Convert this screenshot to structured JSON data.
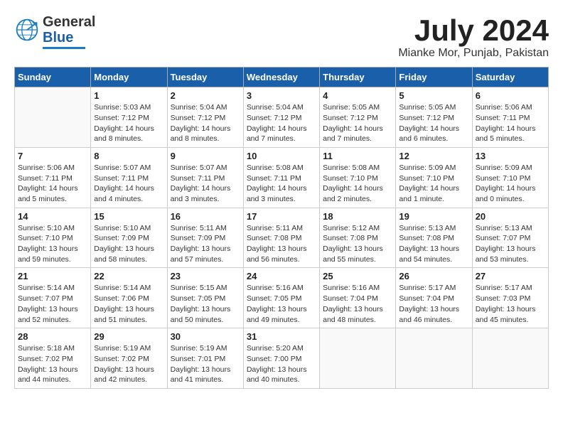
{
  "header": {
    "logo": {
      "line1": "General",
      "line2": "Blue"
    },
    "month": "July 2024",
    "location": "Mianke Mor, Punjab, Pakistan"
  },
  "columns": [
    "Sunday",
    "Monday",
    "Tuesday",
    "Wednesday",
    "Thursday",
    "Friday",
    "Saturday"
  ],
  "weeks": [
    [
      {
        "day": "",
        "sunrise": "",
        "sunset": "",
        "daylight": ""
      },
      {
        "day": "1",
        "sunrise": "Sunrise: 5:03 AM",
        "sunset": "Sunset: 7:12 PM",
        "daylight": "Daylight: 14 hours and 8 minutes."
      },
      {
        "day": "2",
        "sunrise": "Sunrise: 5:04 AM",
        "sunset": "Sunset: 7:12 PM",
        "daylight": "Daylight: 14 hours and 8 minutes."
      },
      {
        "day": "3",
        "sunrise": "Sunrise: 5:04 AM",
        "sunset": "Sunset: 7:12 PM",
        "daylight": "Daylight: 14 hours and 7 minutes."
      },
      {
        "day": "4",
        "sunrise": "Sunrise: 5:05 AM",
        "sunset": "Sunset: 7:12 PM",
        "daylight": "Daylight: 14 hours and 7 minutes."
      },
      {
        "day": "5",
        "sunrise": "Sunrise: 5:05 AM",
        "sunset": "Sunset: 7:12 PM",
        "daylight": "Daylight: 14 hours and 6 minutes."
      },
      {
        "day": "6",
        "sunrise": "Sunrise: 5:06 AM",
        "sunset": "Sunset: 7:11 PM",
        "daylight": "Daylight: 14 hours and 5 minutes."
      }
    ],
    [
      {
        "day": "7",
        "sunrise": "Sunrise: 5:06 AM",
        "sunset": "Sunset: 7:11 PM",
        "daylight": "Daylight: 14 hours and 5 minutes."
      },
      {
        "day": "8",
        "sunrise": "Sunrise: 5:07 AM",
        "sunset": "Sunset: 7:11 PM",
        "daylight": "Daylight: 14 hours and 4 minutes."
      },
      {
        "day": "9",
        "sunrise": "Sunrise: 5:07 AM",
        "sunset": "Sunset: 7:11 PM",
        "daylight": "Daylight: 14 hours and 3 minutes."
      },
      {
        "day": "10",
        "sunrise": "Sunrise: 5:08 AM",
        "sunset": "Sunset: 7:11 PM",
        "daylight": "Daylight: 14 hours and 3 minutes."
      },
      {
        "day": "11",
        "sunrise": "Sunrise: 5:08 AM",
        "sunset": "Sunset: 7:10 PM",
        "daylight": "Daylight: 14 hours and 2 minutes."
      },
      {
        "day": "12",
        "sunrise": "Sunrise: 5:09 AM",
        "sunset": "Sunset: 7:10 PM",
        "daylight": "Daylight: 14 hours and 1 minute."
      },
      {
        "day": "13",
        "sunrise": "Sunrise: 5:09 AM",
        "sunset": "Sunset: 7:10 PM",
        "daylight": "Daylight: 14 hours and 0 minutes."
      }
    ],
    [
      {
        "day": "14",
        "sunrise": "Sunrise: 5:10 AM",
        "sunset": "Sunset: 7:10 PM",
        "daylight": "Daylight: 13 hours and 59 minutes."
      },
      {
        "day": "15",
        "sunrise": "Sunrise: 5:10 AM",
        "sunset": "Sunset: 7:09 PM",
        "daylight": "Daylight: 13 hours and 58 minutes."
      },
      {
        "day": "16",
        "sunrise": "Sunrise: 5:11 AM",
        "sunset": "Sunset: 7:09 PM",
        "daylight": "Daylight: 13 hours and 57 minutes."
      },
      {
        "day": "17",
        "sunrise": "Sunrise: 5:11 AM",
        "sunset": "Sunset: 7:08 PM",
        "daylight": "Daylight: 13 hours and 56 minutes."
      },
      {
        "day": "18",
        "sunrise": "Sunrise: 5:12 AM",
        "sunset": "Sunset: 7:08 PM",
        "daylight": "Daylight: 13 hours and 55 minutes."
      },
      {
        "day": "19",
        "sunrise": "Sunrise: 5:13 AM",
        "sunset": "Sunset: 7:08 PM",
        "daylight": "Daylight: 13 hours and 54 minutes."
      },
      {
        "day": "20",
        "sunrise": "Sunrise: 5:13 AM",
        "sunset": "Sunset: 7:07 PM",
        "daylight": "Daylight: 13 hours and 53 minutes."
      }
    ],
    [
      {
        "day": "21",
        "sunrise": "Sunrise: 5:14 AM",
        "sunset": "Sunset: 7:07 PM",
        "daylight": "Daylight: 13 hours and 52 minutes."
      },
      {
        "day": "22",
        "sunrise": "Sunrise: 5:14 AM",
        "sunset": "Sunset: 7:06 PM",
        "daylight": "Daylight: 13 hours and 51 minutes."
      },
      {
        "day": "23",
        "sunrise": "Sunrise: 5:15 AM",
        "sunset": "Sunset: 7:05 PM",
        "daylight": "Daylight: 13 hours and 50 minutes."
      },
      {
        "day": "24",
        "sunrise": "Sunrise: 5:16 AM",
        "sunset": "Sunset: 7:05 PM",
        "daylight": "Daylight: 13 hours and 49 minutes."
      },
      {
        "day": "25",
        "sunrise": "Sunrise: 5:16 AM",
        "sunset": "Sunset: 7:04 PM",
        "daylight": "Daylight: 13 hours and 48 minutes."
      },
      {
        "day": "26",
        "sunrise": "Sunrise: 5:17 AM",
        "sunset": "Sunset: 7:04 PM",
        "daylight": "Daylight: 13 hours and 46 minutes."
      },
      {
        "day": "27",
        "sunrise": "Sunrise: 5:17 AM",
        "sunset": "Sunset: 7:03 PM",
        "daylight": "Daylight: 13 hours and 45 minutes."
      }
    ],
    [
      {
        "day": "28",
        "sunrise": "Sunrise: 5:18 AM",
        "sunset": "Sunset: 7:02 PM",
        "daylight": "Daylight: 13 hours and 44 minutes."
      },
      {
        "day": "29",
        "sunrise": "Sunrise: 5:19 AM",
        "sunset": "Sunset: 7:02 PM",
        "daylight": "Daylight: 13 hours and 42 minutes."
      },
      {
        "day": "30",
        "sunrise": "Sunrise: 5:19 AM",
        "sunset": "Sunset: 7:01 PM",
        "daylight": "Daylight: 13 hours and 41 minutes."
      },
      {
        "day": "31",
        "sunrise": "Sunrise: 5:20 AM",
        "sunset": "Sunset: 7:00 PM",
        "daylight": "Daylight: 13 hours and 40 minutes."
      },
      {
        "day": "",
        "sunrise": "",
        "sunset": "",
        "daylight": ""
      },
      {
        "day": "",
        "sunrise": "",
        "sunset": "",
        "daylight": ""
      },
      {
        "day": "",
        "sunrise": "",
        "sunset": "",
        "daylight": ""
      }
    ]
  ]
}
